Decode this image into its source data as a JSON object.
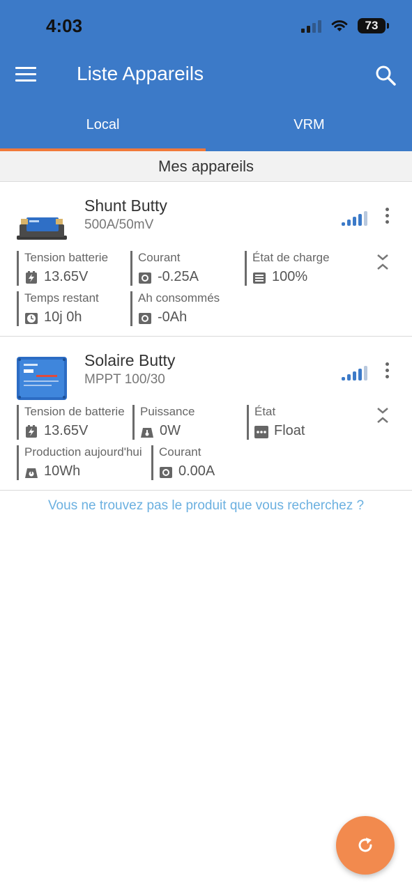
{
  "status": {
    "time": "4:03",
    "battery": "73"
  },
  "header": {
    "title": "Liste Appareils"
  },
  "tabs": [
    {
      "label": "Local"
    },
    {
      "label": "VRM"
    }
  ],
  "section": {
    "title": "Mes appareils"
  },
  "devices": [
    {
      "name": "Shunt Butty",
      "model": "500A/50mV",
      "stats": [
        {
          "label": "Tension batterie",
          "value": "13.65V",
          "icon": "battery-bolt-icon"
        },
        {
          "label": "Courant",
          "value": "-0.25A",
          "icon": "current-icon"
        },
        {
          "label": "État de charge",
          "value": "100%",
          "icon": "charge-state-icon"
        },
        {
          "label": "Temps restant",
          "value": "10j 0h",
          "icon": "clock-icon"
        },
        {
          "label": "Ah consommés",
          "value": "-0Ah",
          "icon": "current-icon"
        }
      ]
    },
    {
      "name": "Solaire Butty",
      "model": "MPPT 100/30",
      "stats": [
        {
          "label": "Tension de batterie",
          "value": "13.65V",
          "icon": "battery-bolt-icon"
        },
        {
          "label": "Puissance",
          "value": "0W",
          "icon": "power-icon"
        },
        {
          "label": "État",
          "value": "Float",
          "icon": "state-icon"
        },
        {
          "label": "Production aujourd'hui",
          "value": "10Wh",
          "icon": "energy-icon"
        },
        {
          "label": "Courant",
          "value": "0.00A",
          "icon": "current-icon"
        }
      ]
    }
  ],
  "footer": {
    "not_found": "Vous ne trouvez pas le produit que vous recherchez ?"
  },
  "colors": {
    "primary": "#3c7ac8",
    "accent": "#f1793a",
    "fab": "#f28a4e",
    "link": "#6bb0e0"
  }
}
